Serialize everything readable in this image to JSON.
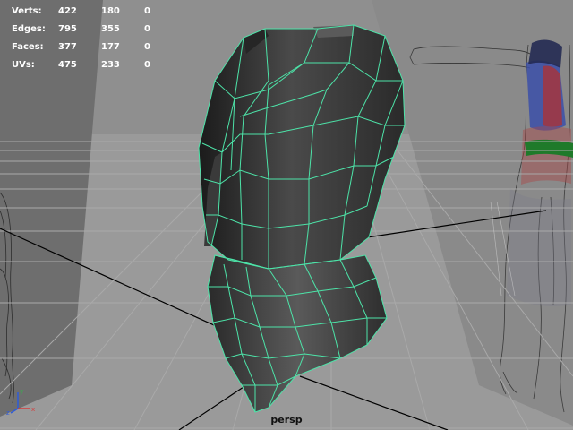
{
  "heads_up_display": {
    "rows": [
      {
        "label": "Verts:",
        "values": [
          "422",
          "180",
          "0"
        ]
      },
      {
        "label": "Edges:",
        "values": [
          "795",
          "355",
          "0"
        ]
      },
      {
        "label": "Faces:",
        "values": [
          "377",
          "177",
          "0"
        ]
      },
      {
        "label": "UVs:",
        "values": [
          "475",
          "233",
          "0"
        ]
      }
    ]
  },
  "viewport": {
    "camera": "persp",
    "background_color": "#8f8f8f",
    "wireframe_color": "#4de3a8",
    "grid_color": "#a9a9a9",
    "axis_line_color": "#000000"
  },
  "axis_gizmo": {
    "x_label": "x",
    "y_label": "y",
    "z_label": "z"
  }
}
